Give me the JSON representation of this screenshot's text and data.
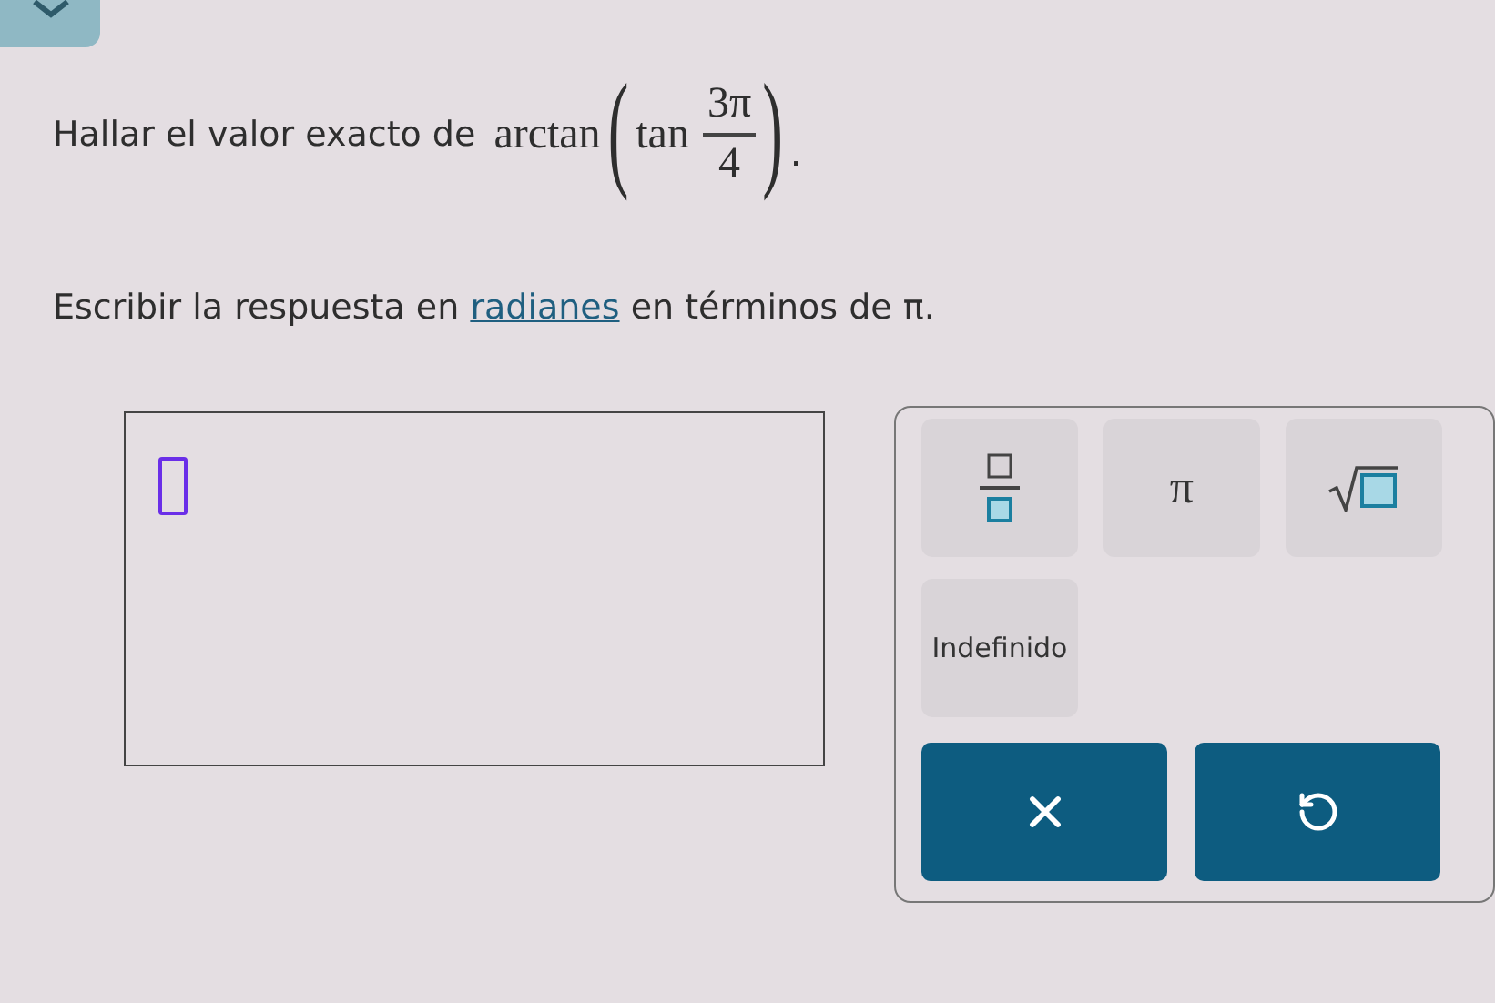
{
  "question": {
    "prefix": "Hallar el valor exacto de",
    "func": "arctan",
    "open": "(",
    "inner_func": "tan",
    "numerator": "3π",
    "denominator": "4",
    "close": ")",
    "suffix": "."
  },
  "instruction": {
    "before": "Escribir la respuesta en",
    "link": "radianes",
    "after": "en términos de π."
  },
  "keys": [
    {
      "kind": "fraction"
    },
    {
      "kind": "symbol",
      "label": "π"
    },
    {
      "kind": "sqrt"
    },
    {
      "kind": "text",
      "label": "Indefinido"
    }
  ],
  "actions": [
    {
      "kind": "clear"
    },
    {
      "kind": "undo"
    }
  ]
}
